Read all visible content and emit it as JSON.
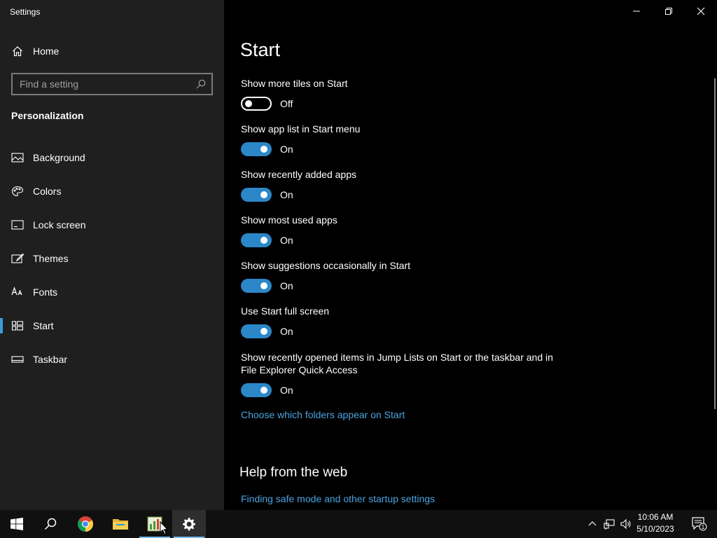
{
  "window": {
    "title": "Settings"
  },
  "sidebar": {
    "home_label": "Home",
    "search_placeholder": "Find a setting",
    "section_title": "Personalization",
    "items": [
      {
        "label": "Background",
        "icon": "picture-icon"
      },
      {
        "label": "Colors",
        "icon": "palette-icon"
      },
      {
        "label": "Lock screen",
        "icon": "lock-screen-icon"
      },
      {
        "label": "Themes",
        "icon": "brush-icon"
      },
      {
        "label": "Fonts",
        "icon": "font-icon"
      },
      {
        "label": "Start",
        "icon": "start-layout-icon",
        "active": true
      },
      {
        "label": "Taskbar",
        "icon": "taskbar-icon"
      }
    ]
  },
  "main": {
    "title": "Start",
    "settings": [
      {
        "label": "Show more tiles on Start",
        "state": "Off",
        "on": false
      },
      {
        "label": "Show app list in Start menu",
        "state": "On",
        "on": true
      },
      {
        "label": "Show recently added apps",
        "state": "On",
        "on": true
      },
      {
        "label": "Show most used apps",
        "state": "On",
        "on": true
      },
      {
        "label": "Show suggestions occasionally in Start",
        "state": "On",
        "on": true
      },
      {
        "label": "Use Start full screen",
        "state": "On",
        "on": true
      },
      {
        "label": "Show recently opened items in Jump Lists on Start or the taskbar and in File Explorer Quick Access",
        "state": "On",
        "on": true
      }
    ],
    "folders_link": "Choose which folders appear on Start",
    "help_title": "Help from the web",
    "help_link": "Finding safe mode and other startup settings"
  },
  "taskbar": {
    "apps": [
      "windows-start-icon",
      "search-icon",
      "chrome-icon",
      "file-explorer-icon",
      "spreadsheet-app-icon",
      "settings-gear-icon"
    ],
    "clock_time": "10:06 AM",
    "clock_date": "5/10/2023",
    "notification_count": "1"
  },
  "colors": {
    "accent": "#2b87c8",
    "link": "#4aa3df",
    "sidebar_bg": "#1f1f1f",
    "main_bg": "#000000"
  }
}
